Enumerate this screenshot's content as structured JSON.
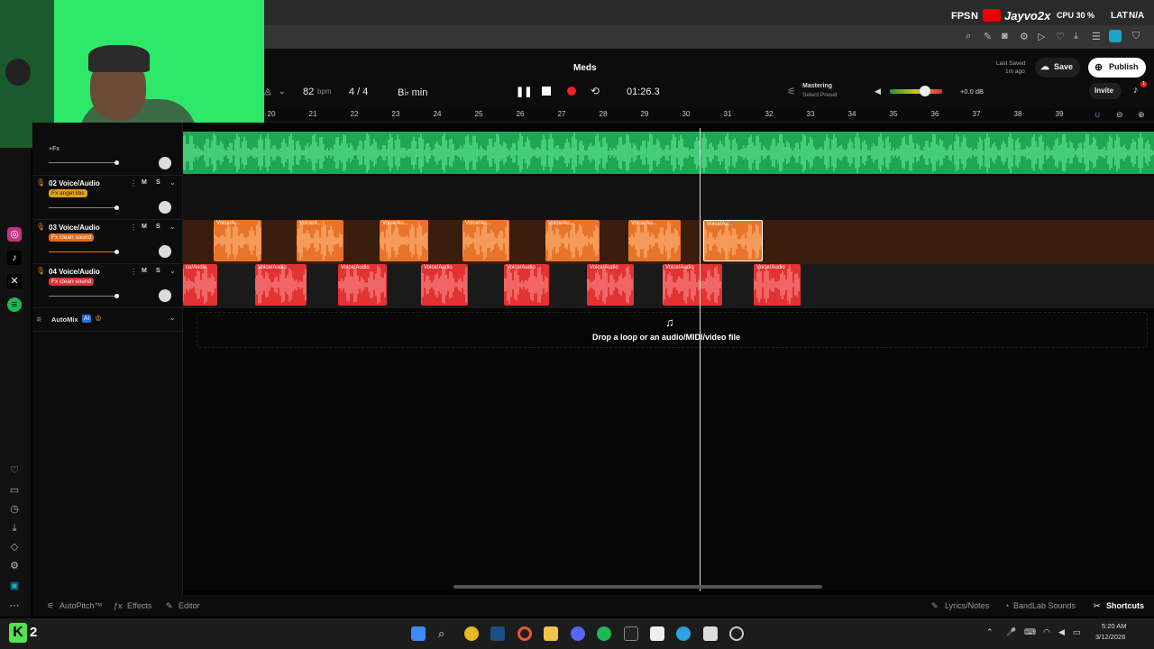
{
  "overlay": {
    "fps": "FPS",
    "n": "N",
    "channel": "Jayvo2x",
    "cpu": "CPU 30 %",
    "lat": "LAT",
    "na": "N/A"
  },
  "project": {
    "title": "Meds",
    "bpm": "82",
    "bpm_unit": "bpm",
    "time_signature": "4 / 4",
    "key": "B♭ min",
    "time": "01:26.3",
    "mastering_label": "Mastering",
    "mastering_sub": "Select Preset",
    "volume_db": "+0.0 dB",
    "last_saved_label": "Last Saved",
    "last_saved_value": "1m ago",
    "save": "Save",
    "publish": "Publish",
    "invite": "Invite",
    "notif_count": "1"
  },
  "ruler": [
    "20",
    "21",
    "22",
    "23",
    "24",
    "25",
    "26",
    "27",
    "28",
    "29",
    "30",
    "31",
    "32",
    "33",
    "34",
    "35",
    "36",
    "37",
    "38",
    "39"
  ],
  "tracks": [
    {
      "name": "02 Voice/Audio",
      "fx": "Fx angel libs",
      "m": "M",
      "s": "S"
    },
    {
      "name": "03 Voice/Audio",
      "fx": "Fx clean sound",
      "m": "M",
      "s": "S"
    },
    {
      "name": "04 Voice/Audio",
      "fx": "Fx clean sound",
      "m": "M",
      "s": "S"
    }
  ],
  "top_track_fx": "+Fx",
  "automix": {
    "label": "AutoMix",
    "badge": "AI"
  },
  "clips": {
    "orange": [
      "Voice/A...",
      "Voice/A...",
      "Voice/Au...",
      "Voice/Au...",
      "Voice/Au...",
      "Voice/Au...",
      "Voice/Au..."
    ],
    "red": [
      "ce/Audio",
      "Voice/Audio",
      "Voice/Audio",
      "Voice/Audio",
      "Voice/Audio",
      "Voice/Audio",
      "Voice/Audio",
      "Voice/Audio"
    ]
  },
  "drop_hint": "Drop a loop or an audio/MIDI/video file",
  "bottom_bar": {
    "autopitch": "AutoPitch™",
    "effects": "Effects",
    "editor": "Editor",
    "lyrics": "Lyrics/Notes",
    "bandlab": "BandLab Sounds",
    "shortcuts": "Shortcuts"
  },
  "taskbar": {
    "kick_count": "2",
    "time": "5:20 AM",
    "date": "3/12/2026"
  },
  "colors": {
    "green": "#2ee86a",
    "orange": "#e8742a",
    "red": "#e23232",
    "accent": "#1aa6c4"
  }
}
